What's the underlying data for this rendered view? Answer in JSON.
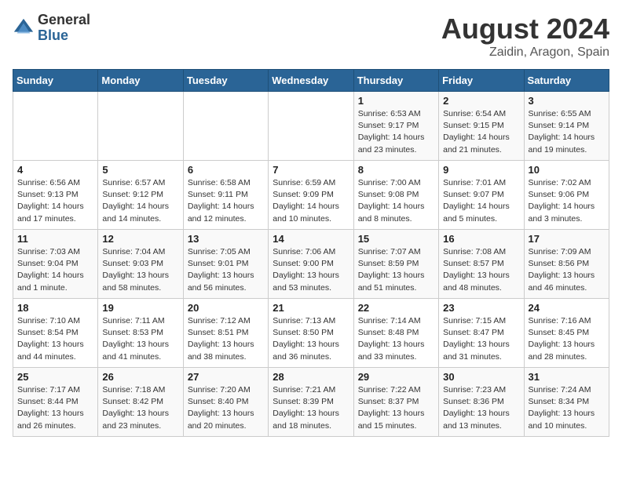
{
  "logo": {
    "general": "General",
    "blue": "Blue"
  },
  "title": "August 2024",
  "location": "Zaidin, Aragon, Spain",
  "days_header": [
    "Sunday",
    "Monday",
    "Tuesday",
    "Wednesday",
    "Thursday",
    "Friday",
    "Saturday"
  ],
  "weeks": [
    [
      {
        "day": "",
        "detail": ""
      },
      {
        "day": "",
        "detail": ""
      },
      {
        "day": "",
        "detail": ""
      },
      {
        "day": "",
        "detail": ""
      },
      {
        "day": "1",
        "detail": "Sunrise: 6:53 AM\nSunset: 9:17 PM\nDaylight: 14 hours\nand 23 minutes."
      },
      {
        "day": "2",
        "detail": "Sunrise: 6:54 AM\nSunset: 9:15 PM\nDaylight: 14 hours\nand 21 minutes."
      },
      {
        "day": "3",
        "detail": "Sunrise: 6:55 AM\nSunset: 9:14 PM\nDaylight: 14 hours\nand 19 minutes."
      }
    ],
    [
      {
        "day": "4",
        "detail": "Sunrise: 6:56 AM\nSunset: 9:13 PM\nDaylight: 14 hours\nand 17 minutes."
      },
      {
        "day": "5",
        "detail": "Sunrise: 6:57 AM\nSunset: 9:12 PM\nDaylight: 14 hours\nand 14 minutes."
      },
      {
        "day": "6",
        "detail": "Sunrise: 6:58 AM\nSunset: 9:11 PM\nDaylight: 14 hours\nand 12 minutes."
      },
      {
        "day": "7",
        "detail": "Sunrise: 6:59 AM\nSunset: 9:09 PM\nDaylight: 14 hours\nand 10 minutes."
      },
      {
        "day": "8",
        "detail": "Sunrise: 7:00 AM\nSunset: 9:08 PM\nDaylight: 14 hours\nand 8 minutes."
      },
      {
        "day": "9",
        "detail": "Sunrise: 7:01 AM\nSunset: 9:07 PM\nDaylight: 14 hours\nand 5 minutes."
      },
      {
        "day": "10",
        "detail": "Sunrise: 7:02 AM\nSunset: 9:06 PM\nDaylight: 14 hours\nand 3 minutes."
      }
    ],
    [
      {
        "day": "11",
        "detail": "Sunrise: 7:03 AM\nSunset: 9:04 PM\nDaylight: 14 hours\nand 1 minute."
      },
      {
        "day": "12",
        "detail": "Sunrise: 7:04 AM\nSunset: 9:03 PM\nDaylight: 13 hours\nand 58 minutes."
      },
      {
        "day": "13",
        "detail": "Sunrise: 7:05 AM\nSunset: 9:01 PM\nDaylight: 13 hours\nand 56 minutes."
      },
      {
        "day": "14",
        "detail": "Sunrise: 7:06 AM\nSunset: 9:00 PM\nDaylight: 13 hours\nand 53 minutes."
      },
      {
        "day": "15",
        "detail": "Sunrise: 7:07 AM\nSunset: 8:59 PM\nDaylight: 13 hours\nand 51 minutes."
      },
      {
        "day": "16",
        "detail": "Sunrise: 7:08 AM\nSunset: 8:57 PM\nDaylight: 13 hours\nand 48 minutes."
      },
      {
        "day": "17",
        "detail": "Sunrise: 7:09 AM\nSunset: 8:56 PM\nDaylight: 13 hours\nand 46 minutes."
      }
    ],
    [
      {
        "day": "18",
        "detail": "Sunrise: 7:10 AM\nSunset: 8:54 PM\nDaylight: 13 hours\nand 44 minutes."
      },
      {
        "day": "19",
        "detail": "Sunrise: 7:11 AM\nSunset: 8:53 PM\nDaylight: 13 hours\nand 41 minutes."
      },
      {
        "day": "20",
        "detail": "Sunrise: 7:12 AM\nSunset: 8:51 PM\nDaylight: 13 hours\nand 38 minutes."
      },
      {
        "day": "21",
        "detail": "Sunrise: 7:13 AM\nSunset: 8:50 PM\nDaylight: 13 hours\nand 36 minutes."
      },
      {
        "day": "22",
        "detail": "Sunrise: 7:14 AM\nSunset: 8:48 PM\nDaylight: 13 hours\nand 33 minutes."
      },
      {
        "day": "23",
        "detail": "Sunrise: 7:15 AM\nSunset: 8:47 PM\nDaylight: 13 hours\nand 31 minutes."
      },
      {
        "day": "24",
        "detail": "Sunrise: 7:16 AM\nSunset: 8:45 PM\nDaylight: 13 hours\nand 28 minutes."
      }
    ],
    [
      {
        "day": "25",
        "detail": "Sunrise: 7:17 AM\nSunset: 8:44 PM\nDaylight: 13 hours\nand 26 minutes."
      },
      {
        "day": "26",
        "detail": "Sunrise: 7:18 AM\nSunset: 8:42 PM\nDaylight: 13 hours\nand 23 minutes."
      },
      {
        "day": "27",
        "detail": "Sunrise: 7:20 AM\nSunset: 8:40 PM\nDaylight: 13 hours\nand 20 minutes."
      },
      {
        "day": "28",
        "detail": "Sunrise: 7:21 AM\nSunset: 8:39 PM\nDaylight: 13 hours\nand 18 minutes."
      },
      {
        "day": "29",
        "detail": "Sunrise: 7:22 AM\nSunset: 8:37 PM\nDaylight: 13 hours\nand 15 minutes."
      },
      {
        "day": "30",
        "detail": "Sunrise: 7:23 AM\nSunset: 8:36 PM\nDaylight: 13 hours\nand 13 minutes."
      },
      {
        "day": "31",
        "detail": "Sunrise: 7:24 AM\nSunset: 8:34 PM\nDaylight: 13 hours\nand 10 minutes."
      }
    ]
  ]
}
